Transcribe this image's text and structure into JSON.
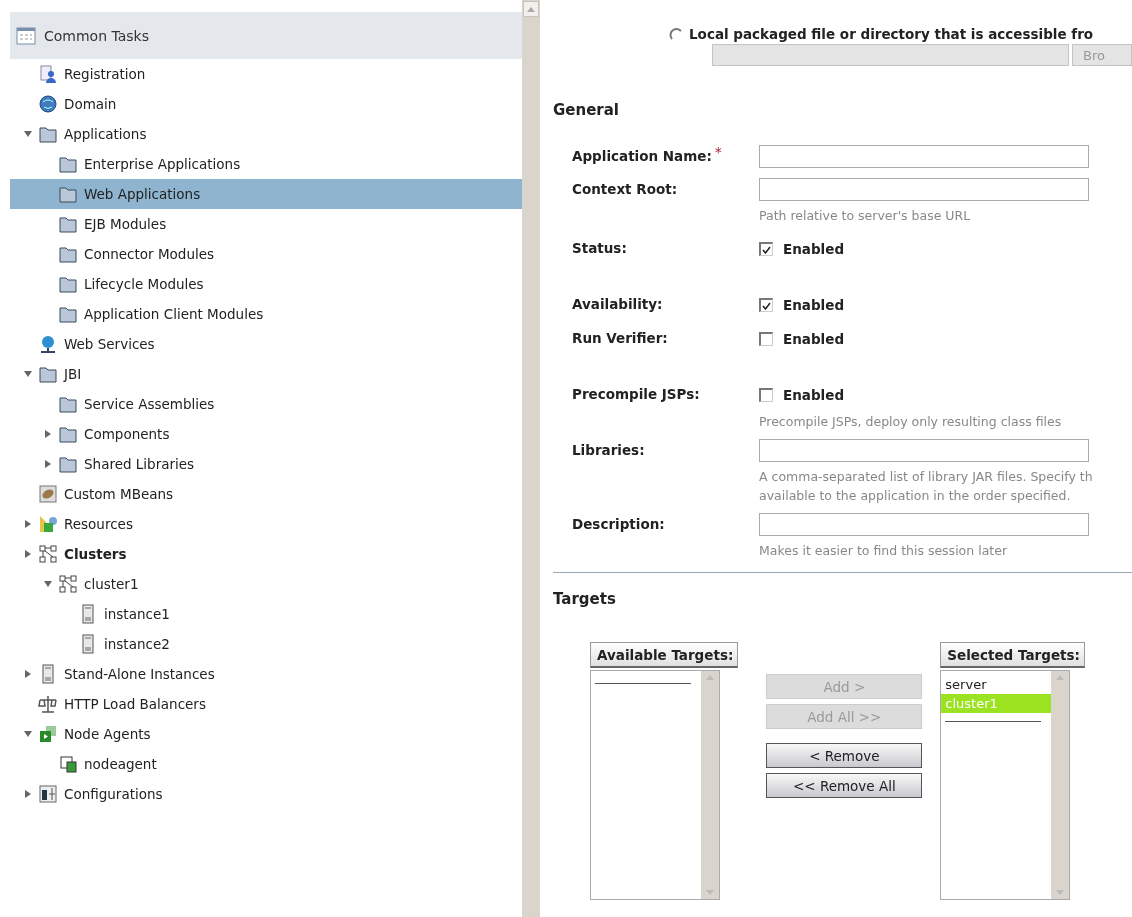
{
  "tree": {
    "header": "Common Tasks",
    "items": [
      {
        "label": "Registration",
        "kind": "registration",
        "selected": false
      },
      {
        "label": "Domain",
        "kind": "globe",
        "selected": false
      },
      {
        "label": "Applications",
        "kind": "folder",
        "selected": false,
        "expanded": true,
        "children": [
          {
            "label": "Enterprise Applications",
            "kind": "folder",
            "selected": false
          },
          {
            "label": "Web Applications",
            "kind": "folder",
            "selected": true
          },
          {
            "label": "EJB Modules",
            "kind": "folder",
            "selected": false
          },
          {
            "label": "Connector Modules",
            "kind": "folder",
            "selected": false
          },
          {
            "label": "Lifecycle Modules",
            "kind": "folder",
            "selected": false
          },
          {
            "label": "Application Client Modules",
            "kind": "folder",
            "selected": false
          }
        ]
      },
      {
        "label": "Web Services",
        "kind": "webservice",
        "selected": false
      },
      {
        "label": "JBI",
        "kind": "folder",
        "selected": false,
        "expanded": true,
        "children": [
          {
            "label": "Service Assemblies",
            "kind": "folder",
            "selected": false
          },
          {
            "label": "Components",
            "kind": "folder",
            "selected": false,
            "expanded": false
          },
          {
            "label": "Shared Libraries",
            "kind": "folder",
            "selected": false,
            "expanded": false
          }
        ]
      },
      {
        "label": "Custom MBeans",
        "kind": "beans",
        "selected": false
      },
      {
        "label": "Resources",
        "kind": "resources",
        "selected": false,
        "expanded": false
      },
      {
        "label": "Clusters",
        "kind": "cluster",
        "selected": false,
        "expanded": false,
        "bold": true,
        "children": [
          {
            "label": "cluster1",
            "kind": "cluster",
            "selected": false,
            "expanded": true,
            "children": [
              {
                "label": "instance1",
                "kind": "server",
                "selected": false
              },
              {
                "label": "instance2",
                "kind": "server",
                "selected": false
              }
            ]
          }
        ]
      },
      {
        "label": "Stand-Alone Instances",
        "kind": "server",
        "selected": false,
        "expanded": false
      },
      {
        "label": "HTTP Load Balancers",
        "kind": "balancer",
        "selected": false
      },
      {
        "label": "Node Agents",
        "kind": "nodeagent",
        "selected": false,
        "expanded": true,
        "children": [
          {
            "label": "nodeagent",
            "kind": "agent",
            "selected": false
          }
        ]
      },
      {
        "label": "Configurations",
        "kind": "config",
        "selected": false,
        "expanded": false
      }
    ]
  },
  "source": {
    "label": "Local packaged file or directory that is accessible fro",
    "selected": false,
    "browse_button": "Bro"
  },
  "general": {
    "title": "General",
    "fields": [
      {
        "kind": "text",
        "label": "Application Name:",
        "required_mark": "*"
      },
      {
        "kind": "text",
        "label": "Context Root:",
        "hint": "Path relative to server's base URL"
      },
      {
        "kind": "checkbox",
        "label": "Status:",
        "option": "Enabled",
        "checked": true
      },
      {
        "kind": "checkbox",
        "label": "Availability:",
        "option": "Enabled",
        "checked": true
      },
      {
        "kind": "checkbox",
        "label": "Run Verifier:",
        "option": "Enabled",
        "checked": false
      },
      {
        "kind": "checkbox",
        "label": "Precompile JSPs:",
        "option": "Enabled",
        "checked": false,
        "hint": "Precompile JSPs, deploy only resulting class files"
      },
      {
        "kind": "text",
        "label": "Libraries:",
        "hint": "A comma-separated list of library JAR files. Specify th",
        "hint_2": "available to the application in the order specified."
      },
      {
        "kind": "text",
        "label": "Description:",
        "hint": "Makes it easier to find this session later"
      }
    ]
  },
  "targets": {
    "title": "Targets",
    "available": {
      "header": "Available Targets:"
    },
    "selected": {
      "header": "Selected Targets:",
      "items": [
        {
          "label": "server",
          "selected": false
        },
        {
          "label": "cluster1",
          "selected": true
        }
      ]
    },
    "buttons": [
      {
        "label": "Add >",
        "disabled": true
      },
      {
        "label": "Add All >>",
        "disabled": true
      },
      {
        "label": "< Remove",
        "disabled": false
      },
      {
        "label": "<< Remove All",
        "disabled": false
      }
    ]
  }
}
